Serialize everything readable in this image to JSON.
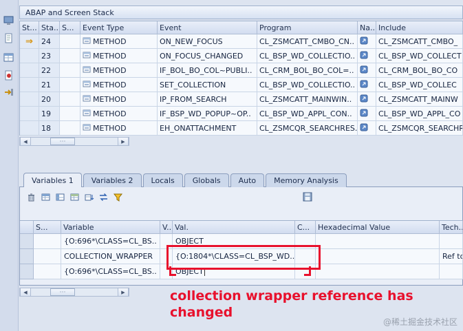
{
  "panel_title": {
    "text": "ABAP and Screen Stack"
  },
  "stack": {
    "headers": {
      "st": "St...",
      "sta": "Sta...",
      "s": "S...",
      "event_type": "Event Type",
      "event": "Event",
      "program": "Program",
      "na": "Na...",
      "include": "Include"
    },
    "rows": [
      {
        "pointer": "⇒",
        "no": "24",
        "event_type": "METHOD",
        "event": "ON_NEW_FOCUS",
        "program": "CL_ZSMCATT_CMBO_CN..",
        "include": "CL_ZSMCATT_CMBO_"
      },
      {
        "pointer": "",
        "no": "23",
        "event_type": "METHOD",
        "event": "ON_FOCUS_CHANGED",
        "program": "CL_BSP_WD_COLLECTIO..",
        "include": "CL_BSP_WD_COLLECT"
      },
      {
        "pointer": "",
        "no": "22",
        "event_type": "METHOD",
        "event": "IF_BOL_BO_COL~PUBLI..",
        "program": "CL_CRM_BOL_BO_COL=..",
        "include": "CL_CRM_BOL_BO_CO"
      },
      {
        "pointer": "",
        "no": "21",
        "event_type": "METHOD",
        "event": "SET_COLLECTION",
        "program": "CL_BSP_WD_COLLECTIO..",
        "include": "CL_BSP_WD_COLLEC"
      },
      {
        "pointer": "",
        "no": "20",
        "event_type": "METHOD",
        "event": "IP_FROM_SEARCH",
        "program": "CL_ZSMCATT_MAINWIN..",
        "include": "CL_ZSMCATT_MAINW"
      },
      {
        "pointer": "",
        "no": "19",
        "event_type": "METHOD",
        "event": "IF_BSP_WD_POPUP~OP..",
        "program": "CL_BSP_WD_APPL_CON..",
        "include": "CL_BSP_WD_APPL_CO"
      },
      {
        "pointer": "",
        "no": "18",
        "event_type": "METHOD",
        "event": "EH_ONATTACHMENT",
        "program": "CL_ZSMCQR_SEARCHRES..",
        "include": "CL_ZSMCQR_SEARCHR"
      }
    ]
  },
  "scrollbar": {
    "left_arrow": "◀",
    "right_arrow": "▶"
  },
  "tabs": [
    {
      "label": "Variables 1"
    },
    {
      "label": "Variables 2"
    },
    {
      "label": "Locals"
    },
    {
      "label": "Globals"
    },
    {
      "label": "Auto"
    },
    {
      "label": "Memory Analysis"
    }
  ],
  "toolbar": {
    "icon_names": [
      "delete",
      "layout-table-1",
      "layout-table-2",
      "layout-table-3",
      "sort-table",
      "swap-layout",
      "filter",
      "save"
    ]
  },
  "variables": {
    "headers": {
      "s": "S...",
      "variable": "Variable",
      "v": "V...",
      "val": "Val.",
      "c": "C...",
      "hex": "Hexadecimal Value",
      "tech": "Tech..."
    },
    "rows": [
      {
        "variable": "{O:696*\\CLASS=CL_BS..",
        "val": "OBJECT",
        "tech": ""
      },
      {
        "variable": "COLLECTION_WRAPPER",
        "val": "{O:1804*\\CLASS=CL_BSP_WD..",
        "tech": "Ref to"
      },
      {
        "variable": "{O:696*\\CLASS=CL_BS..",
        "val": "OBJECT",
        "tech": ""
      }
    ]
  },
  "annotation": {
    "text": "collection wrapper reference has changed",
    "color": "#e8112d"
  },
  "watermark": {
    "text": "@稀土掘金技术社区"
  }
}
